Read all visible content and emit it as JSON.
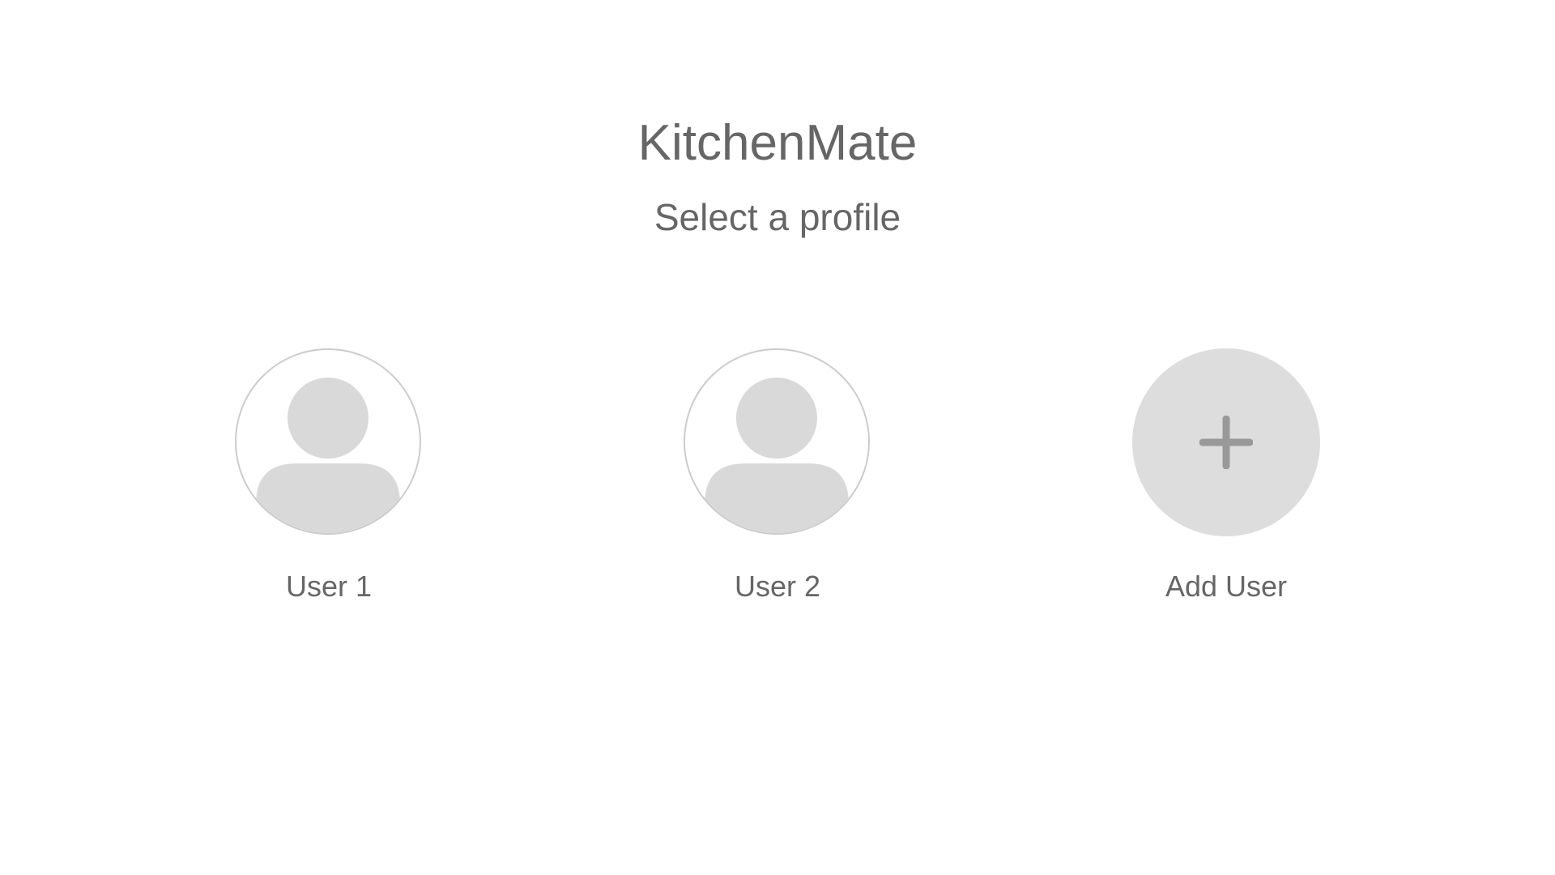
{
  "app": {
    "title": "KitchenMate",
    "subtitle": "Select a profile"
  },
  "profiles": [
    {
      "label": "User 1",
      "icon": "user-avatar-icon"
    },
    {
      "label": "User 2",
      "icon": "user-avatar-icon"
    }
  ],
  "add_user": {
    "label": "Add User",
    "icon": "plus-icon"
  },
  "colors": {
    "text": "#666666",
    "avatar_fill": "#d9d9d9",
    "avatar_border": "#cccccc",
    "add_button_fill": "#dddddd",
    "plus_icon": "#999999"
  }
}
